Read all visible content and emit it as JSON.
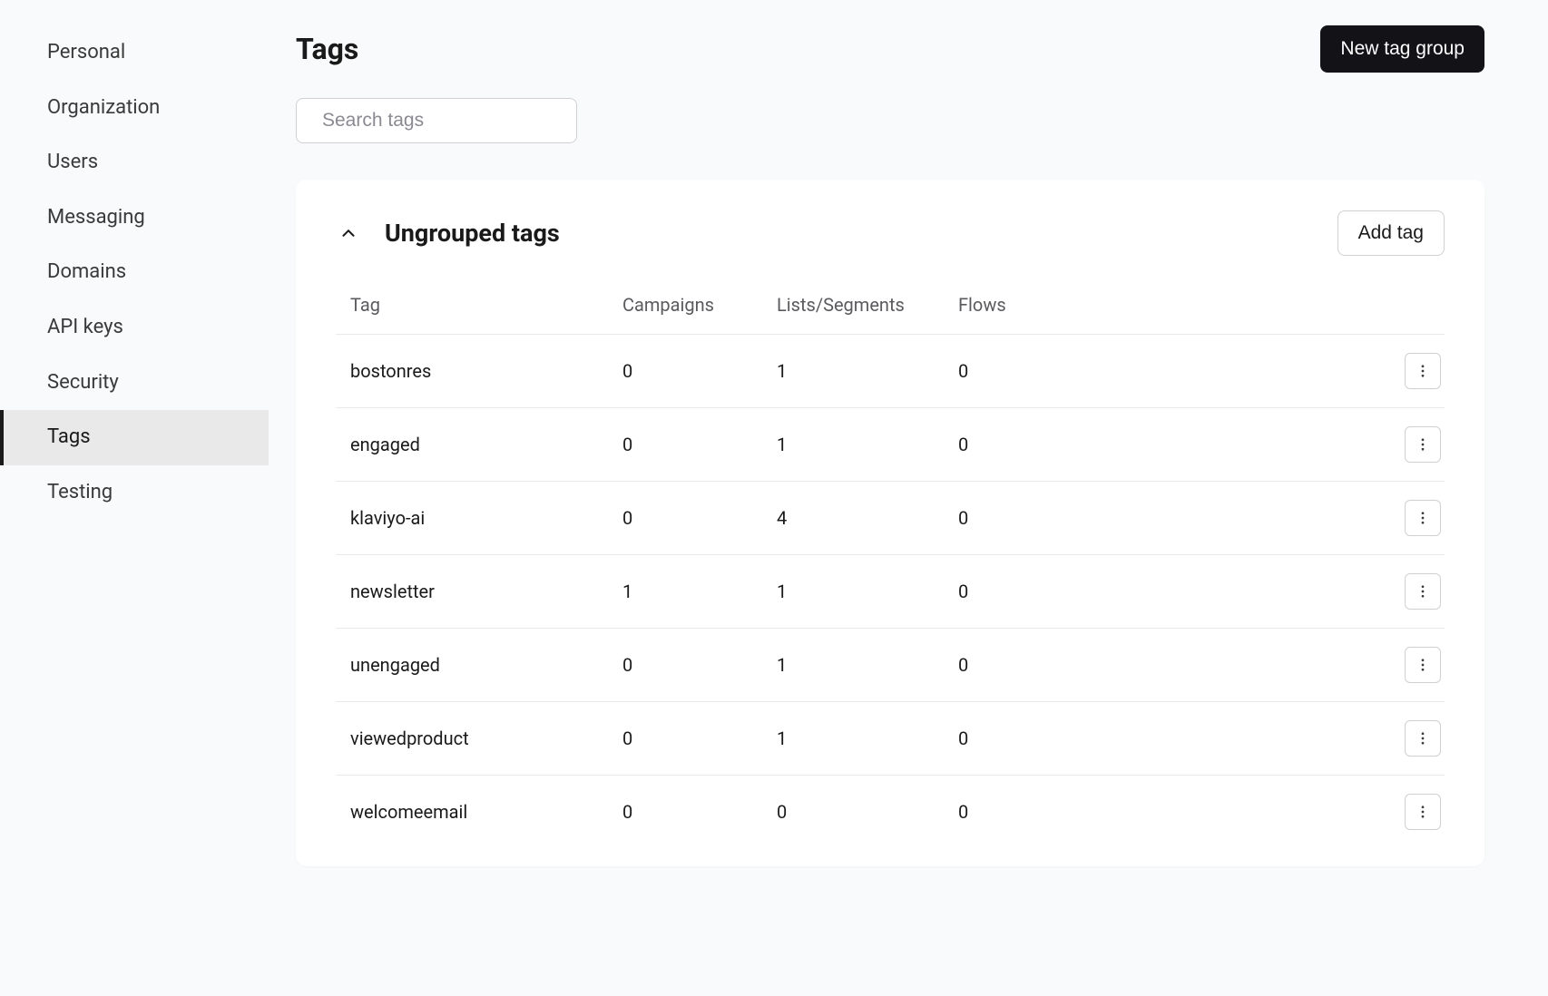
{
  "sidebar": {
    "items": [
      {
        "label": "Personal",
        "active": false
      },
      {
        "label": "Organization",
        "active": false
      },
      {
        "label": "Users",
        "active": false
      },
      {
        "label": "Messaging",
        "active": false
      },
      {
        "label": "Domains",
        "active": false
      },
      {
        "label": "API keys",
        "active": false
      },
      {
        "label": "Security",
        "active": false
      },
      {
        "label": "Tags",
        "active": true
      },
      {
        "label": "Testing",
        "active": false
      }
    ]
  },
  "header": {
    "title": "Tags",
    "new_group_button": "New tag group"
  },
  "search": {
    "placeholder": "Search tags"
  },
  "group": {
    "title": "Ungrouped tags",
    "add_tag_button": "Add tag",
    "columns": {
      "tag": "Tag",
      "campaigns": "Campaigns",
      "lists_segments": "Lists/Segments",
      "flows": "Flows"
    },
    "rows": [
      {
        "tag": "bostonres",
        "campaigns": "0",
        "lists_segments": "1",
        "flows": "0"
      },
      {
        "tag": "engaged",
        "campaigns": "0",
        "lists_segments": "1",
        "flows": "0"
      },
      {
        "tag": "klaviyo-ai",
        "campaigns": "0",
        "lists_segments": "4",
        "flows": "0"
      },
      {
        "tag": "newsletter",
        "campaigns": "1",
        "lists_segments": "1",
        "flows": "0"
      },
      {
        "tag": "unengaged",
        "campaigns": "0",
        "lists_segments": "1",
        "flows": "0"
      },
      {
        "tag": "viewedproduct",
        "campaigns": "0",
        "lists_segments": "1",
        "flows": "0"
      },
      {
        "tag": "welcomeemail",
        "campaigns": "0",
        "lists_segments": "0",
        "flows": "0"
      }
    ]
  }
}
